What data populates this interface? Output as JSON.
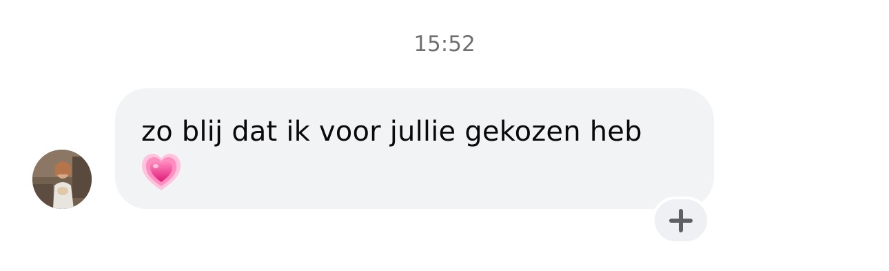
{
  "chat": {
    "timestamp": "15:52",
    "message": {
      "text": "zo blij dat ik voor jullie gekozen heb",
      "emoji": "growing-heart",
      "sender_avatar": "avatar-photo"
    },
    "reaction_icon": "plus-icon"
  },
  "colors": {
    "bubble": "#f2f3f5",
    "text": "#0a0a0a",
    "timestamp": "#6e6e73",
    "heart_pink": "#ee3e8c",
    "plus": "#5f6064"
  }
}
